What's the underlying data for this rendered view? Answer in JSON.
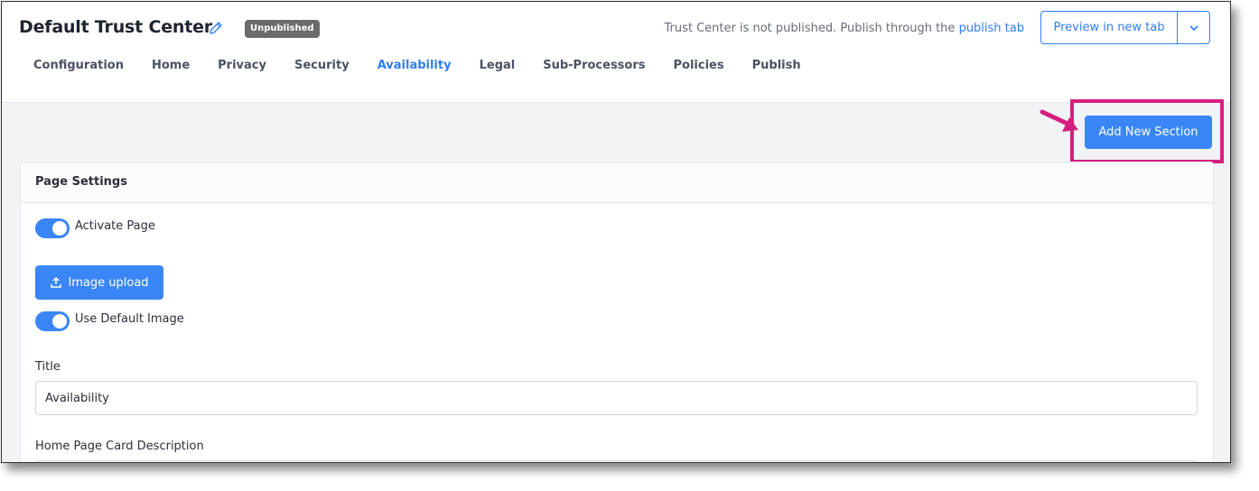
{
  "header": {
    "title": "Default Trust Center",
    "status_badge": "Unpublished",
    "publish_notice_text": "Trust Center is not published. Publish through the",
    "publish_link": "publish tab",
    "preview_button": "Preview in new tab"
  },
  "tabs": [
    {
      "label": "Configuration",
      "active": false
    },
    {
      "label": "Home",
      "active": false
    },
    {
      "label": "Privacy",
      "active": false
    },
    {
      "label": "Security",
      "active": false
    },
    {
      "label": "Availability",
      "active": true
    },
    {
      "label": "Legal",
      "active": false
    },
    {
      "label": "Sub-Processors",
      "active": false
    },
    {
      "label": "Policies",
      "active": false
    },
    {
      "label": "Publish",
      "active": false
    }
  ],
  "actions": {
    "add_section": "Add New Section"
  },
  "page_settings": {
    "heading": "Page Settings",
    "activate_page_label": "Activate Page",
    "activate_page_on": true,
    "image_upload_button": "Image upload",
    "use_default_image_label": "Use Default Image",
    "use_default_image_on": true,
    "title_label": "Title",
    "title_value": "Availability",
    "description_label": "Home Page Card Description"
  },
  "colors": {
    "accent": "#3a86f7",
    "highlight": "#d51f7f",
    "badge": "#6b6b6b"
  },
  "icons": {
    "edit": "pencil-icon",
    "caret": "chevron-down-icon",
    "upload": "upload-icon",
    "annotation": "arrow-icon"
  }
}
